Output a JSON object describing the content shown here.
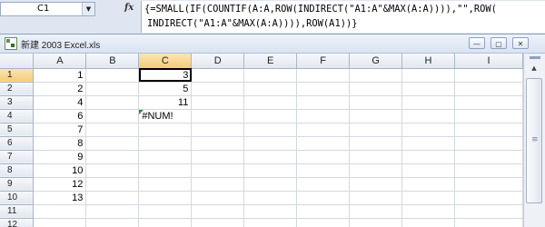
{
  "formula_bar": {
    "name_box": "C1",
    "dropdown_glyph": "▼",
    "fx_label": "fx",
    "formula_line1": "{=SMALL(IF(COUNTIF(A:A,ROW(INDIRECT(\"A1:A\"&MAX(A:A)))),\"\",ROW(",
    "formula_line2": "INDIRECT(\"A1:A\"&MAX(A:A)))),ROW(A1))}"
  },
  "window": {
    "title": "新建 2003 Excel.xls",
    "minimize_glyph": "—",
    "restore_glyph": "▢",
    "close_glyph": "✕"
  },
  "columns": [
    "A",
    "B",
    "C",
    "D",
    "E",
    "F",
    "G",
    "H",
    "I"
  ],
  "rows": [
    {
      "num": "1",
      "A": "1",
      "C": "3"
    },
    {
      "num": "2",
      "A": "2",
      "C": "5"
    },
    {
      "num": "3",
      "A": "4",
      "C": "11"
    },
    {
      "num": "4",
      "A": "6",
      "C": "#NUM!"
    },
    {
      "num": "5",
      "A": "7",
      "C": ""
    },
    {
      "num": "6",
      "A": "8",
      "C": ""
    },
    {
      "num": "7",
      "A": "9",
      "C": ""
    },
    {
      "num": "8",
      "A": "10",
      "C": ""
    },
    {
      "num": "9",
      "A": "12",
      "C": ""
    },
    {
      "num": "10",
      "A": "13",
      "C": ""
    },
    {
      "num": "11",
      "A": "",
      "C": ""
    },
    {
      "num": "12",
      "A": "",
      "C": ""
    }
  ],
  "selected_cell": "C1",
  "error_cell": "C4",
  "scrollbar": {
    "up_glyph": "▲",
    "grip_glyph": "≡"
  },
  "icons": [
    "dropdown-arrow-icon",
    "fx-icon",
    "excel-file-icon",
    "minimize-icon",
    "restore-icon",
    "close-icon",
    "error-indicator-icon"
  ],
  "colors": {
    "chrome": "#dfe6f1",
    "header": "#e2e7ef",
    "active_header": "#f4cb7a",
    "gridline": "#d4d8df",
    "error_triangle": "#2d8a2d"
  }
}
